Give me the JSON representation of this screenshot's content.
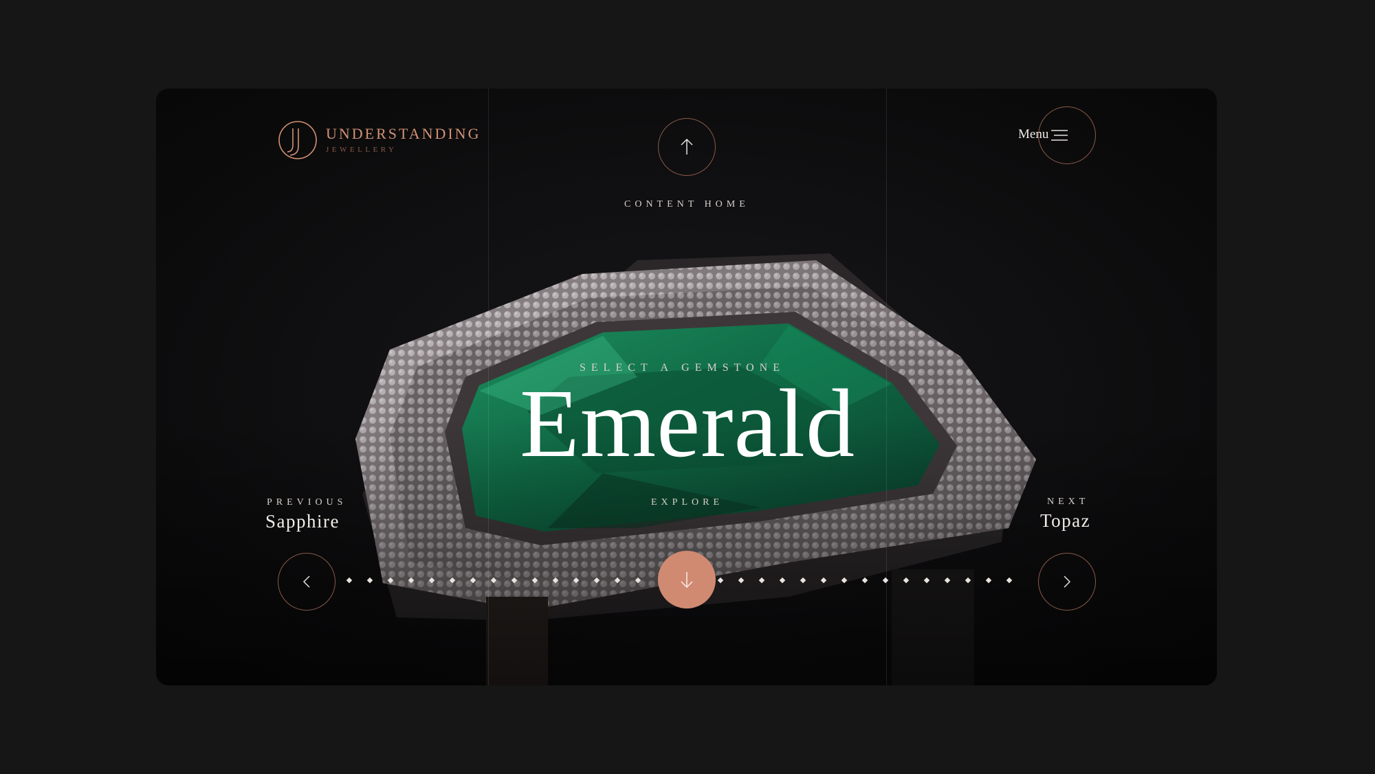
{
  "brand": {
    "title": "UNDERSTANDING",
    "subtitle": "JEWELLERY",
    "color": "#d39274"
  },
  "top_nav": {
    "content_home_label": "CONTENT HOME"
  },
  "menu": {
    "label": "Menu"
  },
  "hero": {
    "eyebrow": "SELECT A GEMSTONE",
    "title": "Emerald"
  },
  "previous": {
    "caption": "PREVIOUS",
    "name": "Sapphire"
  },
  "next": {
    "caption": "NEXT",
    "name": "Topaz"
  },
  "explore": {
    "label": "EXPLORE",
    "button_color": "#d08a72"
  },
  "icons": {
    "up": "arrow-up-icon",
    "down": "arrow-down-icon",
    "prev": "chevron-left-icon",
    "next": "chevron-right-icon",
    "menu": "hamburger-icon"
  }
}
